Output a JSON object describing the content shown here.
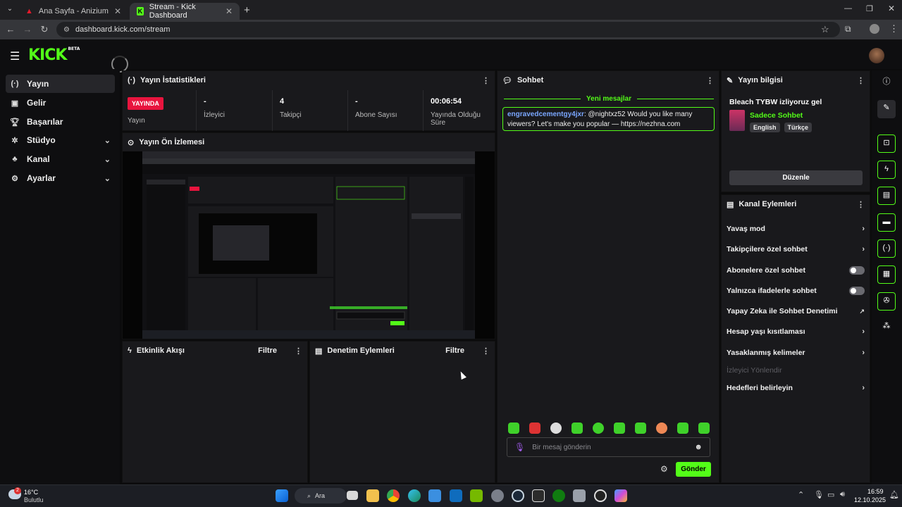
{
  "browser": {
    "tabs": [
      {
        "title": "Ana Sayfa - Anizium"
      },
      {
        "title": "Stream - Kick Dashboard"
      }
    ],
    "url": "dashboard.kick.com/stream"
  },
  "app": {
    "logo": "KICK",
    "logo_badge": "BETA"
  },
  "sidebar": {
    "items": [
      {
        "label": "Yayın",
        "icon": "broadcast-icon",
        "active": true
      },
      {
        "label": "Gelir",
        "icon": "revenue-icon"
      },
      {
        "label": "Başarılar",
        "icon": "trophy-icon"
      },
      {
        "label": "Stüdyo",
        "icon": "studio-icon",
        "expandable": true
      },
      {
        "label": "Kanal",
        "icon": "channel-icon",
        "expandable": true
      },
      {
        "label": "Ayarlar",
        "icon": "gear-icon",
        "expandable": true
      }
    ]
  },
  "stats": {
    "title": "Yayın İstatistikleri",
    "live_badge": "YAYINDA",
    "live_label": "Yayın",
    "viewers_value": "-",
    "viewers_label": "İzleyici",
    "followers_value": "4",
    "followers_label": "Takipçi",
    "subs_value": "-",
    "subs_label": "Abone Sayısı",
    "uptime_value": "00:06:54",
    "uptime_label_1": "Yayında Olduğu",
    "uptime_label_2": "Süre"
  },
  "preview": {
    "title": "Yayın Ön İzlemesi"
  },
  "activity": {
    "title": "Etkinlik Akışı",
    "filter": "Filtre"
  },
  "moderation": {
    "title": "Denetim Eylemleri",
    "filter": "Filtre"
  },
  "chat": {
    "title": "Sohbet",
    "new_messages": "Yeni mesajlar",
    "message": {
      "user": "engravedcementgy4jxr",
      "text": ": @nightxz52 Would you like many viewers? Let's make you popular — https://nezhna.com"
    },
    "input_placeholder": "Bir mesaj gönderin",
    "send_label": "Gönder",
    "accent": "#53fc18"
  },
  "stream_info": {
    "title": "Yayın bilgisi",
    "stream_title": "Bleach TYBW izliyoruz gel",
    "category": "Sadece Sohbet",
    "tags": [
      "English",
      "Türkçe"
    ],
    "edit_label": "Düzenle"
  },
  "channel_actions": {
    "title": "Kanal Eylemleri",
    "items": [
      {
        "label": "Yavaş mod",
        "control": "arrow"
      },
      {
        "label": "Takipçilere özel sohbet",
        "control": "arrow"
      },
      {
        "label": "Abonelere özel sohbet",
        "control": "toggle"
      },
      {
        "label": "Yalnızca ifadelerle sohbet",
        "control": "toggle"
      },
      {
        "label": "Yapay Zeka ile Sohbet Denetimi",
        "control": "external"
      },
      {
        "label": "Hesap yaşı kısıtlaması",
        "control": "arrow"
      },
      {
        "label": "Yasaklanmış kelimeler",
        "control": "arrow"
      },
      {
        "label": "İzleyici Yönlendir",
        "control": "disabled"
      },
      {
        "label": "Hedefleri belirleyin",
        "control": "arrow"
      }
    ]
  },
  "taskbar": {
    "weather_temp": "16°C",
    "weather_desc": "Bulutlu",
    "notification_count": "2",
    "search_label": "Ara",
    "time": "16:59",
    "date": "12.10.2025"
  }
}
